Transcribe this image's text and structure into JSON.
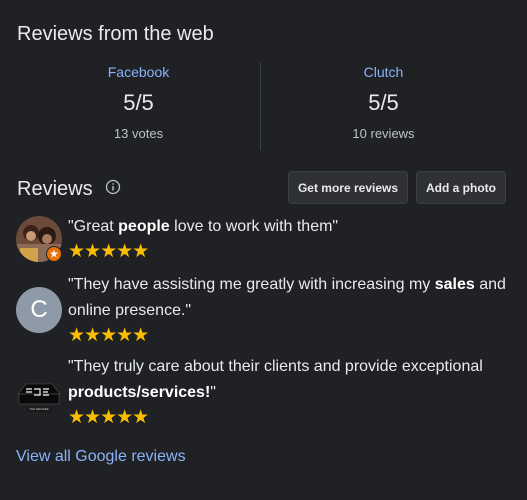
{
  "web_reviews": {
    "title": "Reviews from the web",
    "sources": [
      {
        "name": "Facebook",
        "score": "5/5",
        "count": "13 votes"
      },
      {
        "name": "Clutch",
        "score": "5/5",
        "count": "10 reviews"
      }
    ]
  },
  "reviews": {
    "title": "Reviews",
    "get_more_label": "Get more reviews",
    "add_photo_label": "Add a photo",
    "items": [
      {
        "parts": [
          "\"Great ",
          "people",
          " love to work with them\""
        ],
        "stars": "★★★★★"
      },
      {
        "avatar_letter": "C",
        "parts": [
          "\"They have assisting me greatly with increasing my ",
          "sales",
          " and online presence.\""
        ],
        "stars": "★★★★★"
      },
      {
        "parts": [
          "\"They truly care about their clients and provide exceptional ",
          "products/services!",
          "\""
        ],
        "stars": "★★★★★",
        "logo_text": "THE DEGREE"
      }
    ],
    "view_all_label": "View all Google reviews"
  },
  "colors": {
    "background": "#202124",
    "link": "#8ab4f8",
    "star": "#fbbc04",
    "avatar_c": "#8f9aa8"
  },
  "icons": [
    "info-icon",
    "local-guide-badge-icon"
  ]
}
